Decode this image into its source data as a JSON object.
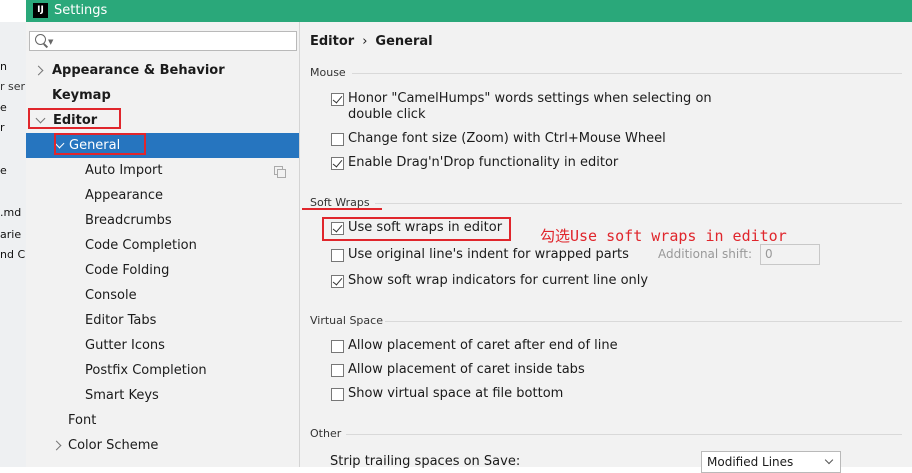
{
  "window": {
    "title": "Settings",
    "app_icon": "IJ"
  },
  "background_fragments": [
    "n",
    "r ser",
    "e",
    "r",
    "e",
    ".md",
    "arie",
    "nd C"
  ],
  "search": {
    "placeholder": ""
  },
  "tree": {
    "items": [
      {
        "label": "Appearance & Behavior"
      },
      {
        "label": "Keymap"
      },
      {
        "label": "Editor"
      },
      {
        "label": "General"
      },
      {
        "label": "Auto Import"
      },
      {
        "label": "Appearance"
      },
      {
        "label": "Breadcrumbs"
      },
      {
        "label": "Code Completion"
      },
      {
        "label": "Code Folding"
      },
      {
        "label": "Console"
      },
      {
        "label": "Editor Tabs"
      },
      {
        "label": "Gutter Icons"
      },
      {
        "label": "Postfix Completion"
      },
      {
        "label": "Smart Keys"
      },
      {
        "label": "Font"
      },
      {
        "label": "Color Scheme"
      }
    ]
  },
  "breadcrumb": {
    "parent": "Editor",
    "separator": "›",
    "current": "General"
  },
  "mouse": {
    "header": "Mouse",
    "options": [
      {
        "line1": "Honor \"CamelHumps\" words settings when selecting on",
        "line2": "double click",
        "checked": true
      },
      {
        "label": "Change font size (Zoom) with Ctrl+Mouse Wheel",
        "checked": false
      },
      {
        "label": "Enable Drag'n'Drop functionality in editor",
        "checked": true
      }
    ]
  },
  "soft_wraps": {
    "header": "Soft Wraps",
    "options": [
      {
        "label": "Use soft wraps in editor",
        "checked": true
      },
      {
        "label": "Use original line's indent for wrapped parts",
        "checked": false
      },
      {
        "label": "Show soft wrap indicators for current line only",
        "checked": true
      }
    ],
    "additional_shift_label": "Additional shift:",
    "additional_shift_value": "0"
  },
  "annotation": "勾选Use soft wraps in editor",
  "virtual_space": {
    "header": "Virtual Space",
    "options": [
      {
        "label": "Allow placement of caret after end of line",
        "checked": false
      },
      {
        "label": "Allow placement of caret inside tabs",
        "checked": false
      },
      {
        "label": "Show virtual space at file bottom",
        "checked": false
      }
    ]
  },
  "other": {
    "header": "Other",
    "strip_label": "Strip trailing spaces on Save:",
    "strip_value": "Modified Lines"
  },
  "colors": {
    "titlebar": "#2aa87a",
    "selection": "#2675bf",
    "annotation_red": "#e0262c"
  }
}
